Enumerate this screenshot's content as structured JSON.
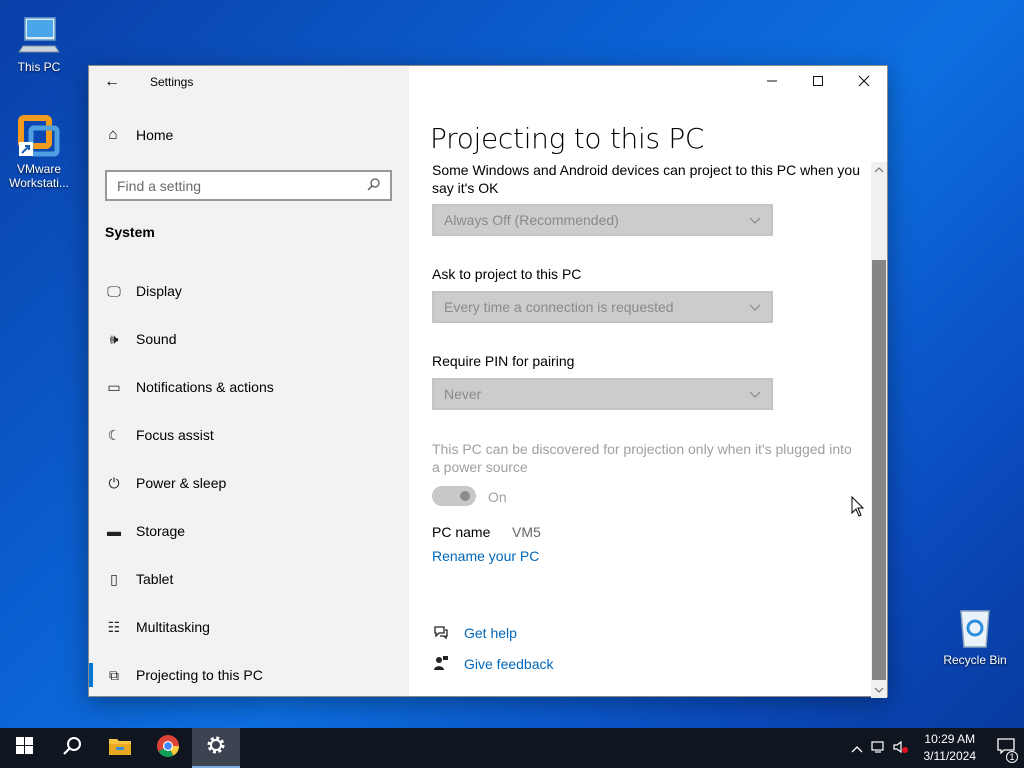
{
  "desktop": {
    "icons": [
      {
        "label": "This PC",
        "icon": "computer-icon"
      },
      {
        "label": "VMware Workstati...",
        "icon": "vmware-icon"
      },
      {
        "label": "Recycle Bin",
        "icon": "recycle-bin-icon"
      }
    ]
  },
  "window": {
    "app_title": "Settings",
    "controls": {
      "minimize": "—",
      "maximize": "☐",
      "close": "✕"
    }
  },
  "nav": {
    "home_label": "Home",
    "search_placeholder": "Find a setting",
    "section": "System",
    "items": [
      {
        "label": "Display",
        "icon": "display-icon"
      },
      {
        "label": "Sound",
        "icon": "sound-icon"
      },
      {
        "label": "Notifications & actions",
        "icon": "notifications-icon"
      },
      {
        "label": "Focus assist",
        "icon": "moon-icon"
      },
      {
        "label": "Power & sleep",
        "icon": "power-icon"
      },
      {
        "label": "Storage",
        "icon": "storage-icon"
      },
      {
        "label": "Tablet",
        "icon": "tablet-icon"
      },
      {
        "label": "Multitasking",
        "icon": "multitasking-icon"
      },
      {
        "label": "Projecting to this PC",
        "icon": "projecting-icon",
        "active": true
      }
    ]
  },
  "content": {
    "title": "Projecting to this PC",
    "intro": "Some Windows and Android devices can project to this PC when you say it's OK",
    "dropdown1": "Always Off (Recommended)",
    "ask_label": "Ask to project to this PC",
    "dropdown2": "Every time a connection is requested",
    "pin_label": "Require PIN for pairing",
    "dropdown3": "Never",
    "plugged_text": "This PC can be discovered for projection only when it's plugged into a power source",
    "toggle_state": "On",
    "pc_name_label": "PC name",
    "pc_name_value": "VM5",
    "rename_link": "Rename your PC",
    "get_help": "Get help",
    "give_feedback": "Give feedback"
  },
  "taskbar": {
    "time": "10:29 AM",
    "date": "3/11/2024",
    "notification_count": "1"
  },
  "colors": {
    "accent": "#0078d7",
    "link": "#0067b8",
    "taskbar": "#101620"
  }
}
